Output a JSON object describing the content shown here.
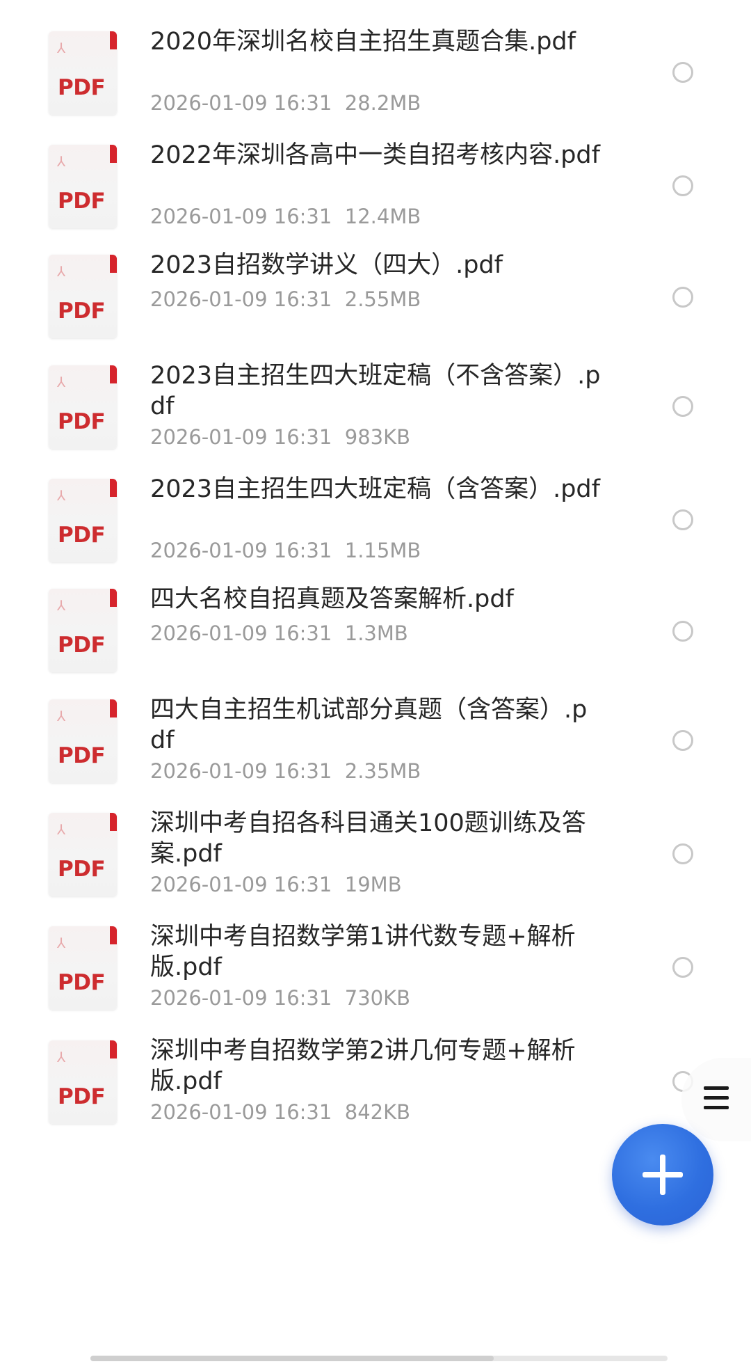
{
  "files": [
    {
      "name": "2020年深圳名校自主招生真题合集.pdf",
      "date": "2026-01-09 16:31",
      "size": "28.2MB",
      "icon": "pdf-file-icon",
      "badge": "PDF"
    },
    {
      "name": "2022年深圳各高中一类自招考核内容.pdf",
      "date": "2026-01-09 16:31",
      "size": "12.4MB",
      "icon": "pdf-file-icon",
      "badge": "PDF"
    },
    {
      "name": "2023自招数学讲义（四大）.pdf",
      "date": "2026-01-09 16:31",
      "size": "2.55MB",
      "icon": "pdf-file-icon",
      "badge": "PDF"
    },
    {
      "name": "2023自主招生四大班定稿（不含答案）.pdf",
      "date": "2026-01-09 16:31",
      "size": "983KB",
      "icon": "pdf-file-icon",
      "badge": "PDF"
    },
    {
      "name": "2023自主招生四大班定稿（含答案）.pdf",
      "date": "2026-01-09 16:31",
      "size": "1.15MB",
      "icon": "pdf-file-icon",
      "badge": "PDF"
    },
    {
      "name": "四大名校自招真题及答案解析.pdf",
      "date": "2026-01-09 16:31",
      "size": "1.3MB",
      "icon": "pdf-file-icon",
      "badge": "PDF"
    },
    {
      "name": "四大自主招生机试部分真题（含答案）.pdf",
      "date": "2026-01-09 16:31",
      "size": "2.35MB",
      "icon": "pdf-file-icon",
      "badge": "PDF"
    },
    {
      "name": "深圳中考自招各科目通关100题训练及答案.pdf",
      "date": "2026-01-09 16:31",
      "size": "19MB",
      "icon": "pdf-file-icon",
      "badge": "PDF"
    },
    {
      "name": "深圳中考自招数学第1讲代数专题+解析版.pdf",
      "date": "2026-01-09 16:31",
      "size": "730KB",
      "icon": "pdf-file-icon",
      "badge": "PDF"
    },
    {
      "name": "深圳中考自招数学第2讲几何专题+解析版.pdf",
      "date": "2026-01-09 16:31",
      "size": "842KB",
      "icon": "pdf-file-icon",
      "badge": "PDF"
    }
  ],
  "menu_icon": "hamburger-menu-icon",
  "fab_icon": "plus-icon",
  "colors": {
    "fab": "#2f6fe0",
    "pdf_red": "#cd2c2f",
    "title_text": "#262626",
    "meta_text": "#9a9a9a"
  }
}
